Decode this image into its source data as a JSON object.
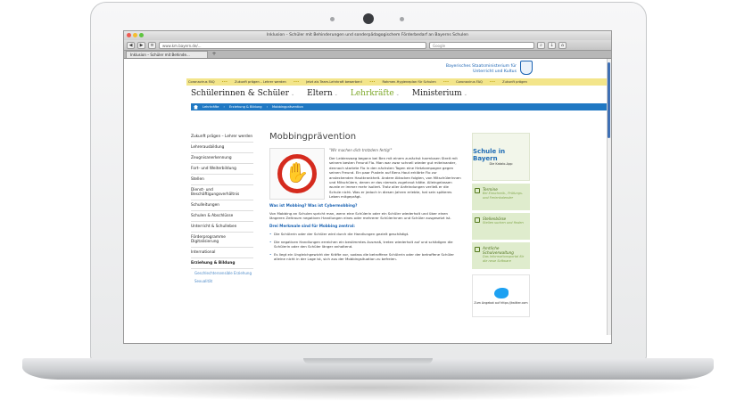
{
  "browser": {
    "window_title": "Inklusion – Schüler mit Behinderungen und sonderpädagogischem Förderbedarf an Bayerns Schulen",
    "url": "www.km.bayern.de/...",
    "search_placeholder": "Google",
    "tab_label": "Inklusion – Schüler mit Behinde...",
    "tab_add": "+",
    "back_label": "◀",
    "forward_label": "▶"
  },
  "header": {
    "ministry_line1": "Bayerisches Staatsministerium für",
    "ministry_line2": "Unterricht und Kultus",
    "ticker": [
      "Coronavirus FAQ",
      "Zukunft prägen – Lehrer werden",
      "Jetzt als Team-Lehrkraft bewerben!",
      "Rahmen-Hygieneplan für Schulen",
      "Coronavirus FAQ",
      "Zukunft prägen"
    ],
    "nav": [
      {
        "label": "Schülerinnen & Schüler"
      },
      {
        "label": "Eltern"
      },
      {
        "label": "Lehrkräfte"
      },
      {
        "label": "Ministerium"
      }
    ],
    "breadcrumb": [
      "Lehrkräfte",
      "Erziehung & Bildung",
      "Mobbingprävention"
    ]
  },
  "sidebar": {
    "items": [
      "Zukunft prägen – Lehrer werden",
      "Lehrerausbildung",
      "Zeugnisanerkennung",
      "Fort- und Weiterbildung",
      "Stellen",
      "Dienst- und Beschäftigungsverhältnis",
      "Schulleitungen",
      "Schulen & Abschlüsse",
      "Unterricht & Schulleben",
      "Förderprogramme Digitalisierung",
      "International",
      "Erziehung & Bildung"
    ],
    "subitems": [
      "Geschlechtersensible Erziehung",
      "Sexualität"
    ]
  },
  "content": {
    "title": "Mobbingprävention",
    "quote": "\"Wir machen dich trotzdem fertig!\"",
    "intro": "Der Leidensweg begann bei Ben mit einem zunächst harmlosen Streit mit seinem besten Freund Flo. Man war zwar schnell wieder gut miteinander, dennoch startete Flo in den nächsten Tagen eine Hetzkampagne gegen seinen Freund. Ein paar Pusteln auf Bens Haut erklärte Flo zur ansteckenden Hautkrankheit. Andere Attacken folgten, von Mitschülerinnen und Mitschülern, denen er das niemals zugetraut hätte. Alleingelassen wurde er immer mehr isoliert. Trotz aller Anfeindungen verließ er die Schule nicht. Was er jedoch in diesen Jahren erlebte, hat sein späteres Leben mitgeprägt.",
    "sub1": "Was ist Mobbing? Was ist Cybermobbing?",
    "para1": "Von Mobbing an Schulen spricht man, wenn eine Schülerin oder ein Schüler wiederholt und über einen längeren Zeitraum negativen Handlungen eines oder mehrerer Schülerinnen und Schüler ausgesetzt ist.",
    "sub2": "Drei Merkmale sind für Mobbing zentral:",
    "bullets": [
      "Die Schülerin oder der Schüler wird durch die Handlungen gezielt geschädigt.",
      "Die negativen Handlungen erreichen ein bestimmtes Ausmaß, treten wiederholt auf und schädigen die Schülerin oder den Schüler länger anhaltend.",
      "Es liegt ein Ungleichgewicht der Kräfte vor, sodass die betroffene Schülerin oder der betroffene Schüler alleine nicht in der Lage ist, sich aus der Mobbingsituation zu befreien."
    ]
  },
  "rightcol": {
    "logo_text": "Schule in Bayern",
    "logo_sub": "Die Katalo-App",
    "widgets": [
      {
        "title": "Termine",
        "text": "Bei Einschreib-, Prüfungs- und Ferienkalender"
      },
      {
        "title": "Stellenbörse",
        "text": "Stellen suchen und finden"
      },
      {
        "title": "Amtliche Schulverwaltung",
        "text": "Das Informationsportal für die neue Software"
      }
    ],
    "twitter_text": "Zum Angebot auf https://twitter.com"
  },
  "colors": {
    "accent": "#1f78c3",
    "green": "#7ca728",
    "ticker": "#f3e58a",
    "stop": "#d52b1e"
  }
}
